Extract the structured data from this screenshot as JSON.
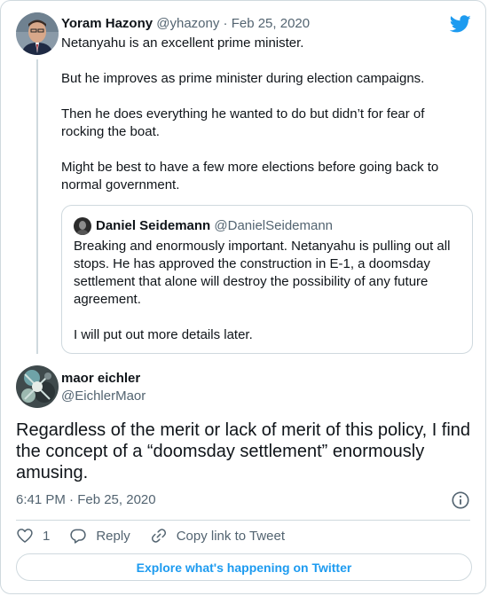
{
  "reply_to": {
    "author_name": "Yoram Hazony",
    "handle_date": "@yhazony · Feb 25, 2020",
    "paragraphs": [
      "Netanyahu is an excellent prime minister.",
      "But he improves as prime minister during election campaigns.",
      "Then he does everything he wanted to do but didn’t for fear of rocking the boat.",
      "Might be best to have a few more elections before going back to normal government."
    ]
  },
  "quoted": {
    "author_name": "Daniel Seidemann",
    "handle": "@DanielSeidemann",
    "paragraphs": [
      "Breaking and enormously important. Netanyahu is pulling out all stops. He has approved the construction in E-1, a doomsday settlement that alone will destroy the possibility of any future agreement.",
      "I will put out more details later."
    ]
  },
  "tweet": {
    "author_name": "maor eichler",
    "handle": "@EichlerMaor",
    "text": "Regardless of the merit or lack of merit of this policy, I find the concept of a “doomsday settlement” enormously amusing.",
    "timestamp": "6:41 PM · Feb 25, 2020"
  },
  "actions": {
    "like_count": "1",
    "reply_label": "Reply",
    "copy_label": "Copy link to Tweet"
  },
  "explore_label": "Explore what's happening on Twitter",
  "colors": {
    "accent": "#1d9bf0",
    "text": "#0f1419",
    "muted": "#536471",
    "border": "#cfd9de"
  },
  "icons": [
    "twitter-bird-icon",
    "info-icon",
    "heart-icon",
    "reply-icon",
    "link-icon"
  ]
}
